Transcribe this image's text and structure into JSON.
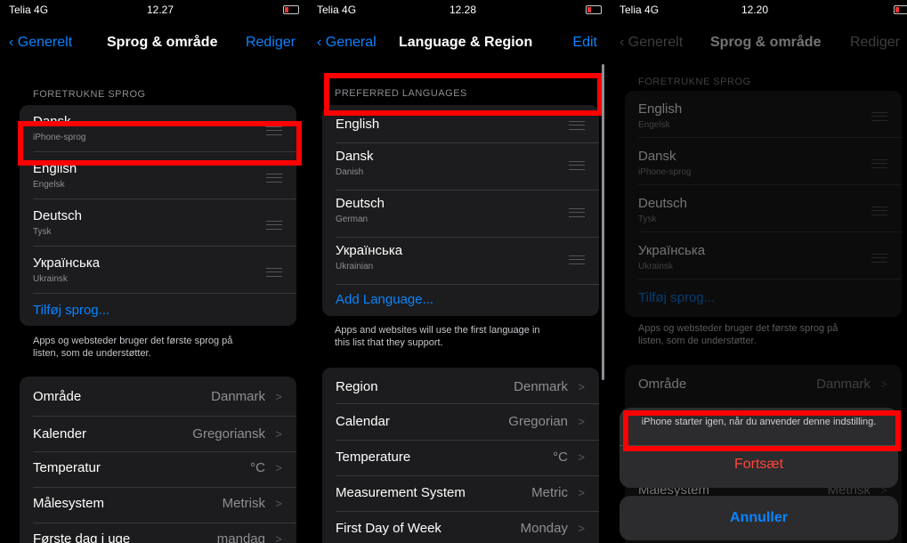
{
  "panel1": {
    "status": {
      "carrier": "Telia 4G",
      "time": "12.27"
    },
    "nav": {
      "back": "Generelt",
      "title": "Sprog & område",
      "edit": "Rediger"
    },
    "section_header": "FORETRUKNE SPROG",
    "languages": [
      {
        "name": "Dansk",
        "sub": "iPhone-sprog"
      },
      {
        "name": "English",
        "sub": "Engelsk"
      },
      {
        "name": "Deutsch",
        "sub": "Tysk"
      },
      {
        "name": "Українська",
        "sub": "Ukrainsk"
      }
    ],
    "add_language": "Tilføj sprog...",
    "footer": [
      "Apps og websteder bruger det første sprog på",
      "listen, som de understøtter."
    ],
    "settings": [
      {
        "label": "Område",
        "value": "Danmark"
      },
      {
        "label": "Kalender",
        "value": "Gregoriansk"
      },
      {
        "label": "Temperatur",
        "value": "°C"
      },
      {
        "label": "Målesystem",
        "value": "Metrisk"
      },
      {
        "label": "Første dag i uge",
        "value": "mandag"
      }
    ]
  },
  "panel2": {
    "status": {
      "carrier": "Telia 4G",
      "time": "12.28"
    },
    "nav": {
      "back": "General",
      "title": "Language & Region",
      "edit": "Edit"
    },
    "section_header": "PREFERRED LANGUAGES",
    "languages": [
      {
        "name": "English",
        "sub": ""
      },
      {
        "name": "Dansk",
        "sub": "Danish"
      },
      {
        "name": "Deutsch",
        "sub": "German"
      },
      {
        "name": "Українська",
        "sub": "Ukrainian"
      }
    ],
    "add_language": "Add Language...",
    "footer": [
      "Apps and websites will use the first language in",
      "this list that they support."
    ],
    "settings": [
      {
        "label": "Region",
        "value": "Denmark"
      },
      {
        "label": "Calendar",
        "value": "Gregorian"
      },
      {
        "label": "Temperature",
        "value": "°C"
      },
      {
        "label": "Measurement System",
        "value": "Metric"
      },
      {
        "label": "First Day of Week",
        "value": "Monday"
      }
    ]
  },
  "panel3": {
    "status": {
      "carrier": "Telia 4G",
      "time": "12.20"
    },
    "nav": {
      "back": "Generelt",
      "title": "Sprog & område",
      "edit": "Rediger"
    },
    "section_header": "FORETRUKNE SPROG",
    "languages": [
      {
        "name": "English",
        "sub": "Engelsk"
      },
      {
        "name": "Dansk",
        "sub": "iPhone-sprog"
      },
      {
        "name": "Deutsch",
        "sub": "Tysk"
      },
      {
        "name": "Українська",
        "sub": "Ukrainsk"
      }
    ],
    "add_language": "Tilføj sprog...",
    "footer": [
      "Apps og websteder bruger det første sprog på",
      "listen, som de understøtter."
    ],
    "settings": [
      {
        "label": "Område",
        "value": "Danmark"
      },
      {
        "label": "Målesystem",
        "value": "Metrisk"
      }
    ],
    "sheet_message": "iPhone starter igen, når du anvender denne indstilling.",
    "continue": "Fortsæt",
    "cancel": "Annuller"
  },
  "colors": {
    "accent": "#0a84ff",
    "destructive": "#ff453a",
    "highlight": "#ff0000"
  }
}
